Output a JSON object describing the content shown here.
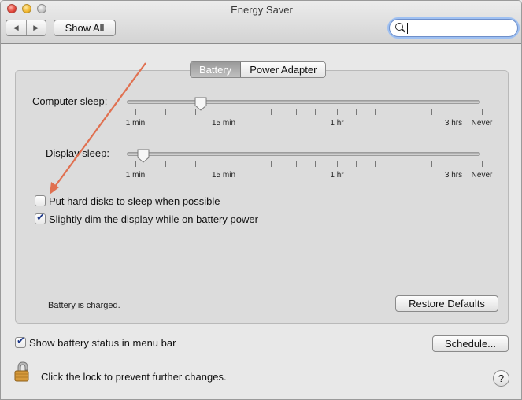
{
  "window": {
    "title": "Energy Saver",
    "nav_back": "◀",
    "nav_forward": "▶",
    "show_all": "Show All",
    "search_value": ""
  },
  "tabs": [
    {
      "label": "Battery",
      "selected": true
    },
    {
      "label": "Power Adapter",
      "selected": false
    }
  ],
  "computer_sleep": {
    "label": "Computer sleep:",
    "value": "5 min",
    "tick_labels": [
      "1 min",
      "15 min",
      "1 hr",
      "3 hrs",
      "Never"
    ]
  },
  "display_sleep": {
    "label": "Display sleep:",
    "value": "2 min",
    "tick_labels": [
      "1 min",
      "15 min",
      "1 hr",
      "3 hrs",
      "Never"
    ]
  },
  "options": {
    "hard_disks": {
      "label": "Put hard disks to sleep when possible",
      "checked": false
    },
    "dim_display": {
      "label": "Slightly dim the display while on battery power",
      "checked": true
    }
  },
  "status_text": "Battery is charged.",
  "restore_defaults": "Restore Defaults",
  "show_battery_status": {
    "label": "Show battery status in menu bar",
    "checked": true
  },
  "schedule_button": "Schedule...",
  "lock_text": "Click the lock to prevent further changes.",
  "help_button": "?",
  "colors": {
    "annotation_arrow": "#e07050",
    "focus_ring": "#9ec0f2",
    "checkmark": "#1f3a8a"
  }
}
